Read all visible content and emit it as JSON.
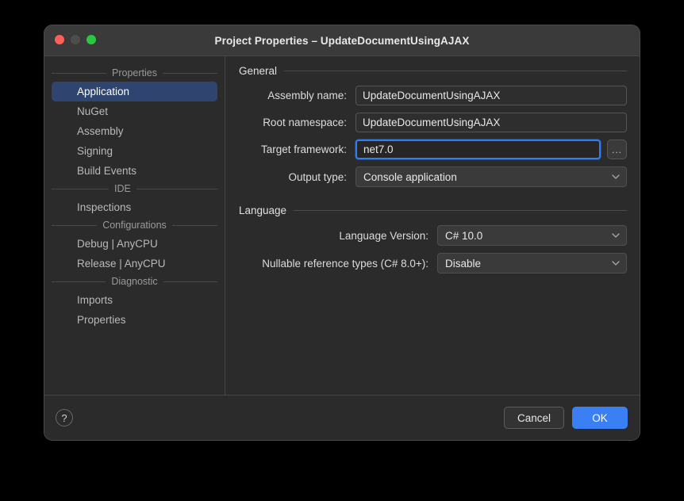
{
  "window": {
    "title": "Project Properties – UpdateDocumentUsingAJAX",
    "traffic_lights": {
      "close": "close-button",
      "minimize": "minimize-button",
      "maximize": "maximize-button"
    },
    "colors": {
      "accent": "#3b7ff5",
      "selection": "#2f4570",
      "focus_ring": "#2d7ff9",
      "background": "#2b2b2b",
      "titlebar": "#3a3a3a"
    }
  },
  "sidebar": {
    "groups": [
      {
        "header": "Properties",
        "items": [
          {
            "label": "Application",
            "selected": true
          },
          {
            "label": "NuGet",
            "selected": false
          },
          {
            "label": "Assembly",
            "selected": false
          },
          {
            "label": "Signing",
            "selected": false
          },
          {
            "label": "Build Events",
            "selected": false
          }
        ]
      },
      {
        "header": "IDE",
        "items": [
          {
            "label": "Inspections",
            "selected": false
          }
        ]
      },
      {
        "header": "Configurations",
        "items": [
          {
            "label": "Debug | AnyCPU",
            "selected": false
          },
          {
            "label": "Release | AnyCPU",
            "selected": false
          }
        ]
      },
      {
        "header": "Diagnostic",
        "items": [
          {
            "label": "Imports",
            "selected": false
          },
          {
            "label": "Properties",
            "selected": false
          }
        ]
      }
    ]
  },
  "main": {
    "general": {
      "header": "General",
      "assembly_name": {
        "label": "Assembly name:",
        "value": "UpdateDocumentUsingAJAX"
      },
      "root_namespace": {
        "label": "Root namespace:",
        "value": "UpdateDocumentUsingAJAX"
      },
      "target_framework": {
        "label": "Target framework:",
        "value": "net7.0",
        "browse_label": "..."
      },
      "output_type": {
        "label": "Output type:",
        "value": "Console application"
      }
    },
    "language": {
      "header": "Language",
      "language_version": {
        "label": "Language Version:",
        "value": "C# 10.0"
      },
      "nullable": {
        "label": "Nullable reference types (C# 8.0+):",
        "value": "Disable"
      }
    }
  },
  "footer": {
    "help_label": "?",
    "cancel_label": "Cancel",
    "ok_label": "OK"
  }
}
